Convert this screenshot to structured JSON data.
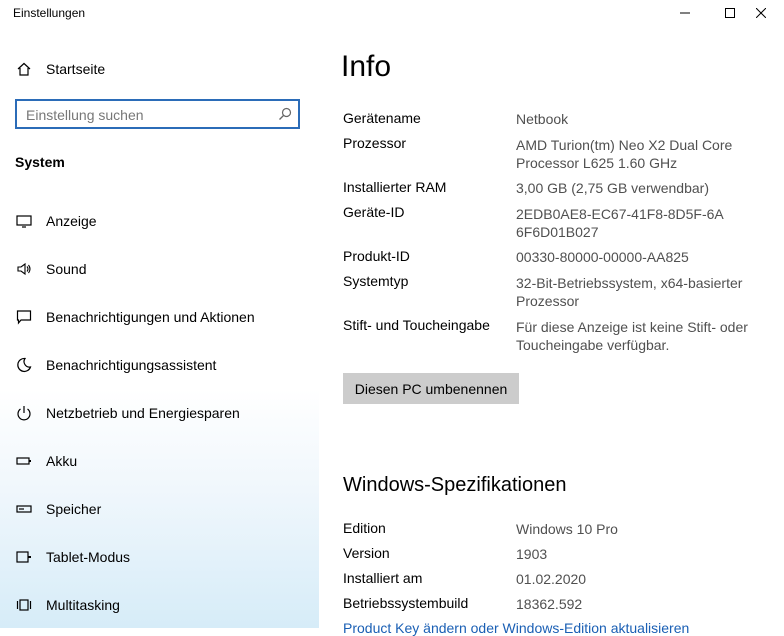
{
  "window": {
    "title": "Einstellungen"
  },
  "sidebar": {
    "home_label": "Startseite",
    "search_placeholder": "Einstellung suchen",
    "section_title": "System",
    "items": [
      {
        "label": "Anzeige",
        "icon": "display-icon"
      },
      {
        "label": "Sound",
        "icon": "speaker-icon"
      },
      {
        "label": "Benachrichtigungen und Aktionen",
        "icon": "notification-icon"
      },
      {
        "label": "Benachrichtigungsassistent",
        "icon": "moon-icon"
      },
      {
        "label": "Netzbetrieb und Energiesparen",
        "icon": "power-icon"
      },
      {
        "label": "Akku",
        "icon": "battery-icon"
      },
      {
        "label": "Speicher",
        "icon": "storage-icon"
      },
      {
        "label": "Tablet-Modus",
        "icon": "tablet-icon"
      },
      {
        "label": "Multitasking",
        "icon": "multitasking-icon"
      }
    ]
  },
  "main": {
    "title": "Info",
    "device": [
      {
        "key": "Gerätename",
        "value": "Netbook"
      },
      {
        "key": "Prozessor",
        "value": "AMD Turion(tm) Neo X2 Dual Core Processor L625   1.60 GHz"
      },
      {
        "key": "Installierter RAM",
        "value": "3,00 GB (2,75 GB verwendbar)"
      },
      {
        "key": "Geräte-ID",
        "value": "2EDB0AE8-EC67-41F8-8D5F-6A6F6D01B027"
      },
      {
        "key": "Produkt-ID",
        "value": "00330-80000-00000-AA825"
      },
      {
        "key": "Systemtyp",
        "value": "32-Bit-Betriebssystem, x64-basierter Prozessor"
      },
      {
        "key": "Stift- und Toucheingabe",
        "value": "Für diese Anzeige ist keine Stift- oder Toucheingabe verfügbar."
      }
    ],
    "rename_button": "Diesen PC umbenennen",
    "windows_spec_title": "Windows-Spezifikationen",
    "windows_spec": [
      {
        "key": "Edition",
        "value": "Windows 10 Pro"
      },
      {
        "key": "Version",
        "value": "1903"
      },
      {
        "key": "Installiert am",
        "value": "01.02.2020"
      },
      {
        "key": "Betriebssystembuild",
        "value": "18362.592"
      }
    ],
    "product_key_link": "Product Key ändern oder Windows-Edition aktualisieren"
  },
  "colors": {
    "accent": "#2b6cb8",
    "link": "#1a5fb4",
    "button": "#cccccc"
  }
}
